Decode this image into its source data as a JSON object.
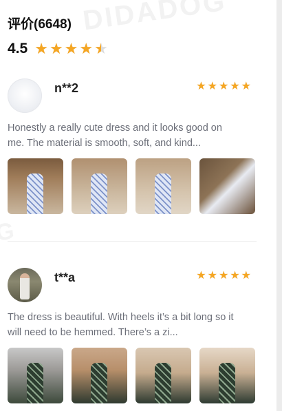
{
  "header": {
    "title": "评价(6648)",
    "rating": "4.5",
    "rating_fraction": 0.9
  },
  "watermark": "DIDADOG",
  "colors": {
    "star": "#f5a623",
    "star_empty": "#dcdcdc",
    "text_muted": "#6b6e78"
  },
  "reviews": [
    {
      "username": "n**2",
      "stars": 5,
      "text": "Honestly a really cute dress and it looks good on me. The material is smooth, soft, and kind...",
      "avatar": "placeholder-avatar",
      "photos": [
        "photo-1",
        "photo-2",
        "photo-3",
        "photo-4"
      ]
    },
    {
      "username": "t**a",
      "stars": 5,
      "text": "The dress is beautiful. With heels it’s a bit long so it will need to be hemmed. There’s a zi...",
      "avatar": "user-photo-avatar",
      "photos": [
        "photo-1",
        "photo-2",
        "photo-3",
        "photo-4"
      ]
    }
  ]
}
